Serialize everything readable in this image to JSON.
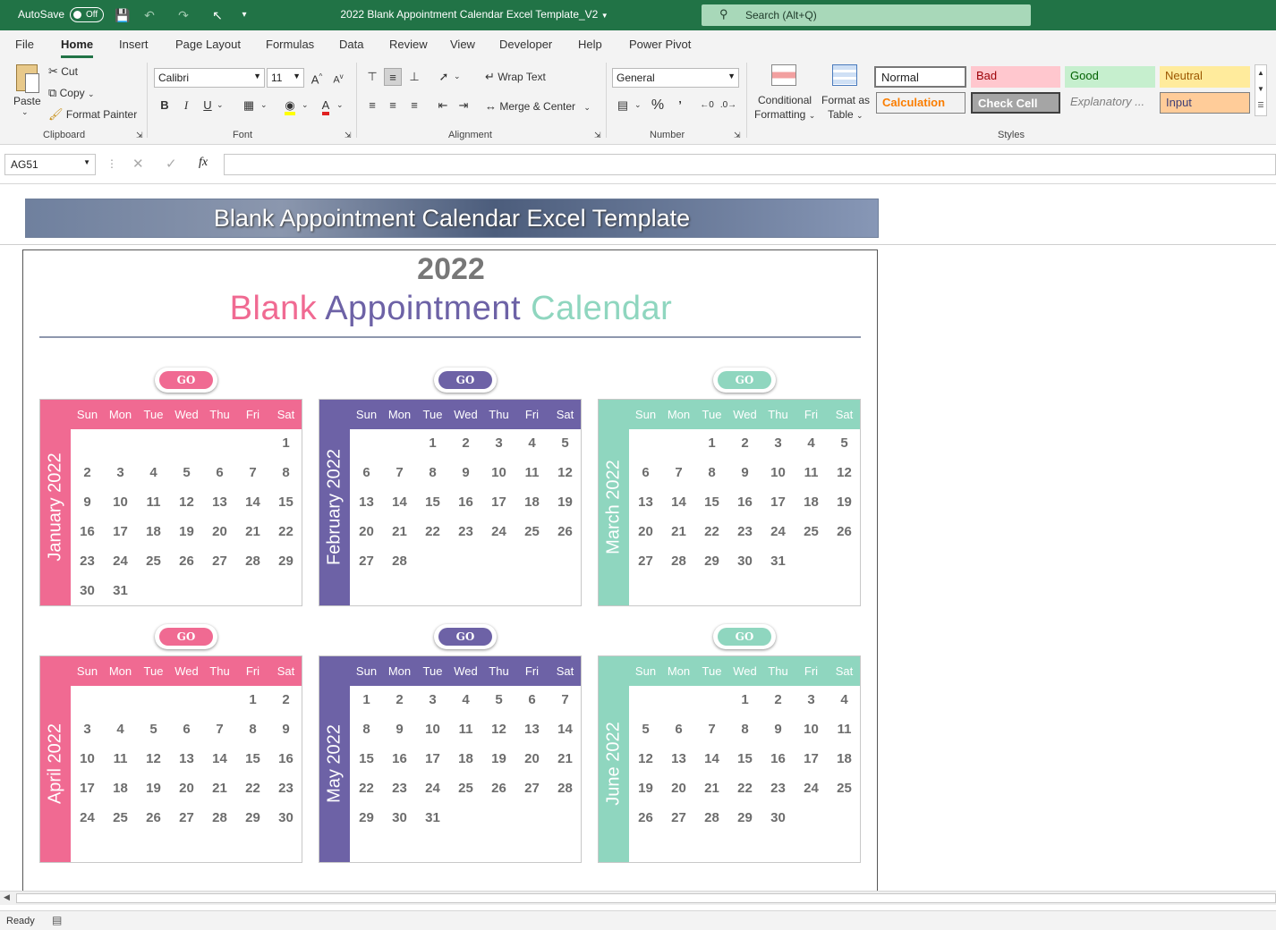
{
  "titlebar": {
    "autosave_label": "AutoSave",
    "autosave_state": "Off",
    "doc_title": "2022 Blank Appointment Calendar Excel Template_V2",
    "search_placeholder": "Search (Alt+Q)"
  },
  "menu": [
    "File",
    "Home",
    "Insert",
    "Page Layout",
    "Formulas",
    "Data",
    "Review",
    "View",
    "Developer",
    "Help",
    "Power Pivot"
  ],
  "ribbon": {
    "clipboard": {
      "paste": "Paste",
      "cut": "Cut",
      "copy": "Copy",
      "format_painter": "Format Painter",
      "group": "Clipboard"
    },
    "font": {
      "name": "Calibri",
      "size": "11",
      "bold": "B",
      "italic": "I",
      "underline": "U",
      "group": "Font"
    },
    "alignment": {
      "wrap": "Wrap Text",
      "merge": "Merge & Center",
      "group": "Alignment"
    },
    "number": {
      "format": "General",
      "group": "Number"
    },
    "styles": {
      "conditional_1": "Conditional",
      "conditional_2": "Formatting",
      "format_table_1": "Format as",
      "format_table_2": "Table",
      "cells": [
        "Normal",
        "Bad",
        "Good",
        "Neutral",
        "Calculation",
        "Check Cell",
        "Explanatory ...",
        "Input"
      ],
      "group": "Styles"
    }
  },
  "formula": {
    "name_box": "AG51",
    "fx": "fx",
    "content": ""
  },
  "sheet": {
    "banner": "Blank Appointment Calendar Excel Template",
    "year": "2022",
    "subtitle": {
      "w1": "Blank",
      "w2": "Appointment",
      "w3": "Calendar"
    },
    "go_label": "GO",
    "weekdays": [
      "Sun",
      "Mon",
      "Tue",
      "Wed",
      "Thu",
      "Fri",
      "Sat"
    ],
    "months": [
      {
        "name": "January 2022",
        "start": 6,
        "days": 31
      },
      {
        "name": "February 2022",
        "start": 2,
        "days": 28
      },
      {
        "name": "March 2022",
        "start": 2,
        "days": 31
      },
      {
        "name": "April 2022",
        "start": 5,
        "days": 30
      },
      {
        "name": "May 2022",
        "start": 0,
        "days": 31
      },
      {
        "name": "June 2022",
        "start": 3,
        "days": 30
      }
    ]
  },
  "colors": {
    "pink": "#f06a92",
    "purple": "#6d62a6",
    "mint": "#8fd6bf",
    "excel_green": "#217346"
  },
  "status": {
    "ready": "Ready"
  }
}
